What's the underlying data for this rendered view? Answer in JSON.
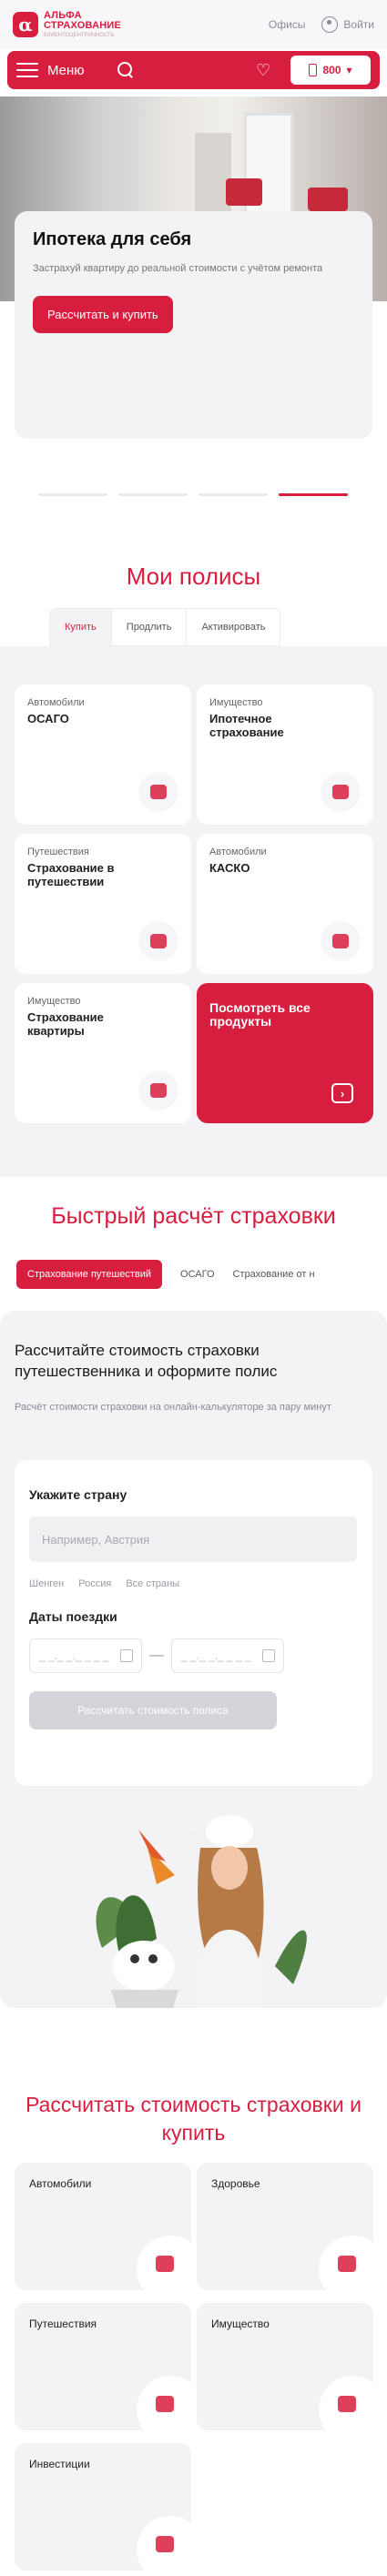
{
  "header": {
    "logo_mark": "α",
    "logo_line1": "АЛЬФА",
    "logo_line2": "СТРАХОВАНИЕ",
    "logo_tagline": "КЛИЕНТОЦЕНТРИЧНОСТЬ",
    "offices": "Офисы",
    "login": "Войти",
    "menu": "Меню",
    "phone_label": "800"
  },
  "hero": {
    "title": "Ипотека для себя",
    "text": "Застрахуй квартиру до реальной стоимости с учётом ремонта",
    "button": "Рассчитать и купить"
  },
  "policies": {
    "title": "Мои полисы",
    "tabs": [
      "Купить",
      "Продлить",
      "Активировать"
    ],
    "cards": [
      {
        "category": "Автомобили",
        "name": "ОСАГО"
      },
      {
        "category": "Имущество",
        "name": "Ипотечное страхование"
      },
      {
        "category": "Путешествия",
        "name": "Страхование в путешествии"
      },
      {
        "category": "Автомобили",
        "name": "КАСКО"
      },
      {
        "category": "Имущество",
        "name": "Страхование квартиры"
      }
    ],
    "all_products": "Посмотреть все продукты"
  },
  "quick_calc": {
    "title": "Быстрый расчёт страховки",
    "tabs": [
      "Страхование путешествий",
      "ОСАГО",
      "Страхование от н"
    ],
    "heading": "Рассчитайте стоимость страховки путешественника и оформите полис",
    "subheading": "Расчёт стоимости страховки на онлайн-калькуляторе за пару минут",
    "country_label": "Укажите страну",
    "country_placeholder": "Например, Австрия",
    "quick_countries": [
      "Шенген",
      "Россия",
      "Все страны"
    ],
    "dates_label": "Даты поездки",
    "date_from_placeholder": "_ _._ _._ _ _ _",
    "date_to_placeholder": "_ _._ _._ _ _ _",
    "dash": "—",
    "calc_button": "Рассчитать стоимость полиса"
  },
  "products": {
    "title": "Рассчитать стоимость страховки и купить",
    "items": [
      "Автомобили",
      "Здоровье",
      "Путешествия",
      "Имущество",
      "Инвестиции"
    ]
  },
  "colors": {
    "brand": "#d81e3f",
    "panel": "#f3f3f6"
  }
}
